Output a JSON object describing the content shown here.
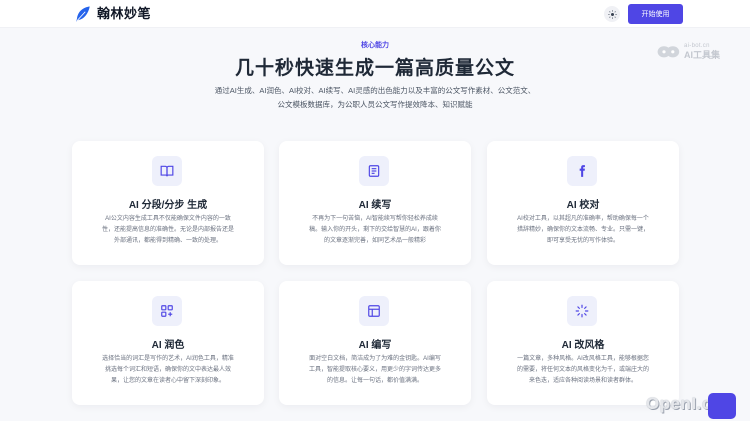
{
  "header": {
    "brand": "翰林妙笔",
    "theme_toggle_icon": "sun-icon",
    "start_button": "开始使用"
  },
  "watermark": {
    "top": "ai-bot.cn",
    "bottom": "AI工具集"
  },
  "hero": {
    "eyebrow": "核心能力",
    "title": "几十秒快速生成一篇高质量公文",
    "description_line1": "通过AI生成、AI润色、AI校对、AI续写、AI灵感的出色能力以及丰富的公文写作素材、公文范文、",
    "description_line2": "公文模板数据库，为公职人员公文写作提效降本、知识赋能"
  },
  "features": [
    {
      "icon": "book-icon",
      "title": "AI 分段/分步 生成",
      "lines": [
        "AI公文内容生成工具不仅能确保文件内容的一致",
        "性，还能提高信息的准确性。无论是内部报告还是",
        "外部通讯，都能得到精确、一致的处理。"
      ]
    },
    {
      "icon": "document-list-icon",
      "title": "AI 续写",
      "lines": [
        "不再为下一句苦恼，AI智能续写帮你轻松养成续",
        "稿。输入你的开头，剩下的交给智慧的AI，跟着你",
        "的文章逐渐完善，如同艺术品一般精彩"
      ]
    },
    {
      "icon": "facebook-icon",
      "title": "AI 校对",
      "lines": [
        "AI校对工具，以其超凡的准确率，帮助确保每一个",
        "措辞精妙，确保你的文本流畅、专业。只需一键，",
        "即可享受无忧的写作体验。"
      ]
    },
    {
      "icon": "grid-plus-icon",
      "title": "AI 润色",
      "lines": [
        "选择恰当的词汇是写作的艺术，AI润色工具，精准",
        "挑选每个词汇和短语，确保你的文中表达最人效",
        "果，让您的文章在读者心中留下深刻印象。"
      ]
    },
    {
      "icon": "layout-icon",
      "title": "AI 编写",
      "lines": [
        "面对空白文档，简洁成为了为难的金钥匙。AI编写",
        "工具，智能提取核心要义，用更少的字词传达更多",
        "的信息。让每一句话，都价值满满。"
      ]
    },
    {
      "icon": "sparkle-icon",
      "title": "AI 改风格",
      "lines": [
        "一篇文章，多种风格。AI改风格工具，能够根据您",
        "的需要，将任何文本的风格变化为千，或端庄大的",
        "来色迭，适应各种阅读场景和读者群体。"
      ]
    }
  ],
  "site_mark": "OpenI.cn",
  "colors": {
    "accent": "#4f46e5",
    "icon_bg": "#eef0fb",
    "background": "#f7f8fb"
  }
}
